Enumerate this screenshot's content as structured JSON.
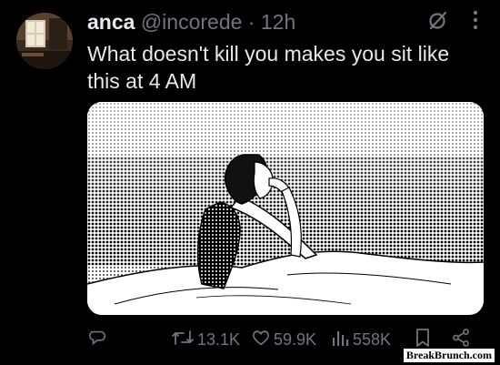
{
  "tweet": {
    "author_name": "anca",
    "handle": "@incorede",
    "separator": "·",
    "time": "12h",
    "text": "What doesn't kill you makes you sit like this at 4 AM"
  },
  "header_icons": [
    "grok-icon",
    "more-icon"
  ],
  "media": {
    "description_icon": "manga-illustration"
  },
  "actions": {
    "reply_count": "",
    "retweet_count": "13.1K",
    "like_count": "59.9K",
    "views_count": "558K"
  },
  "watermark": "BreakBrunch.com",
  "colors": {
    "background": "#000000",
    "text_primary": "#e7e9ea",
    "text_secondary": "#71767b"
  }
}
